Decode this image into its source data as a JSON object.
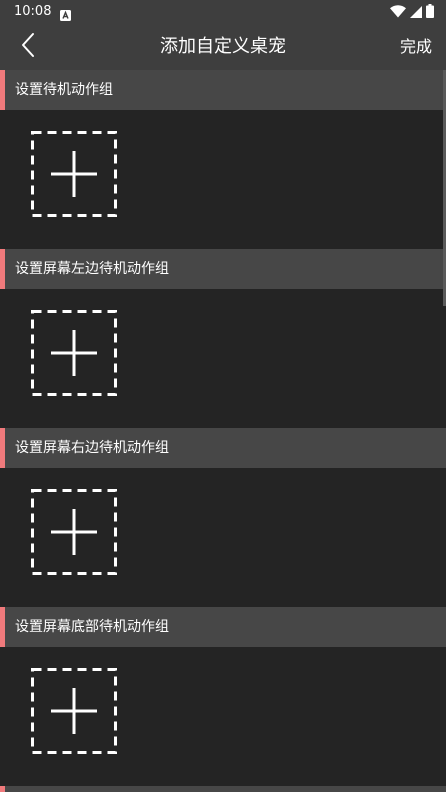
{
  "status_bar": {
    "time": "10:08",
    "icons": [
      "notification-a-icon",
      "wifi-icon",
      "signal-icon",
      "battery-icon"
    ]
  },
  "app_bar": {
    "title": "添加自定义桌宠",
    "done_label": "完成",
    "back_icon": "chevron-left-icon"
  },
  "sections": [
    {
      "label": "设置待机动作组"
    },
    {
      "label": "设置屏幕左边待机动作组"
    },
    {
      "label": "设置屏幕右边待机动作组"
    },
    {
      "label": "设置屏幕底部待机动作组"
    }
  ],
  "colors": {
    "background": "#242424",
    "bar": "#3e3e3e",
    "section_header": "#474747",
    "accent": "#f07a7c",
    "text": "#ffffff"
  }
}
